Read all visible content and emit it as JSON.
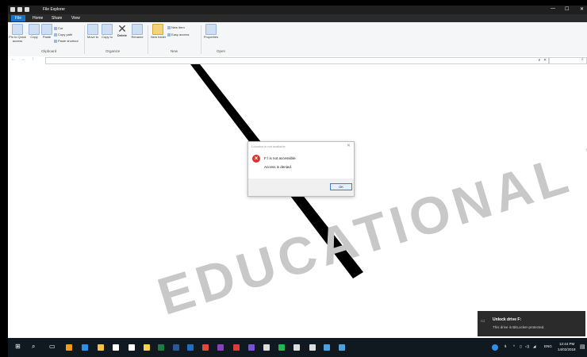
{
  "window": {
    "title": "File Explorer",
    "controls": {
      "minimize": "—",
      "maximize": "☐",
      "close": "✕"
    }
  },
  "tabs": [
    {
      "label": "File"
    },
    {
      "label": "Home"
    },
    {
      "label": "Share"
    },
    {
      "label": "View"
    }
  ],
  "ribbon": {
    "clipboard": {
      "pin": "Pin to Quick access",
      "copy": "Copy",
      "paste": "Paste",
      "cut": "Cut",
      "copy_path": "Copy path",
      "paste_shortcut": "Paste shortcut",
      "group": "Clipboard"
    },
    "organize": {
      "move_to": "Move to",
      "copy_to": "Copy to",
      "delete": "Delete",
      "rename": "Rename",
      "group": "Organize"
    },
    "new": {
      "new_item": "New item",
      "easy_access": "Easy access",
      "new_folder": "New folder",
      "group": "New"
    },
    "open": {
      "properties": "Properties",
      "group": "Open"
    }
  },
  "nav": {
    "back": "←",
    "forward": "→",
    "up": "↑"
  },
  "address": {
    "value": "",
    "dropdown": "∨",
    "clear": "✕"
  },
  "search": {
    "icon": "⌕"
  },
  "dialog": {
    "title": "Location is not available",
    "close": "✕",
    "message": "F:\\ is not accessible.",
    "detail": "Access is denied.",
    "ok_label": "OK"
  },
  "watermark": "EDUCATIONAL PRIVACY",
  "toast": {
    "title": "Unlock drive F:",
    "body": "This drive is BitLocker-protected."
  },
  "taskbar": {
    "apps": [
      {
        "icon": "start-icon",
        "color": "#ffffff"
      },
      {
        "icon": "search-icon",
        "color": "#ffffff"
      },
      {
        "icon": "task-view-icon",
        "color": "#ffffff"
      },
      {
        "icon": "vlc-icon",
        "color": "#f39c12"
      },
      {
        "icon": "edge-icon",
        "color": "#2e8fe8"
      },
      {
        "icon": "file-explorer-icon",
        "color": "#f5c342"
      },
      {
        "icon": "store-icon",
        "color": "#ffffff"
      },
      {
        "icon": "mail-icon",
        "color": "#ffffff"
      },
      {
        "icon": "sticky-notes-icon",
        "color": "#f7d34a"
      },
      {
        "icon": "excel-icon",
        "color": "#1e7b44"
      },
      {
        "icon": "word-icon",
        "color": "#2b579a"
      },
      {
        "icon": "outlook-icon",
        "color": "#1f6fc5"
      },
      {
        "icon": "chrome-icon",
        "color": "#e8453c"
      },
      {
        "icon": "onenote-icon",
        "color": "#8a3fbf"
      },
      {
        "icon": "acrobat-icon",
        "color": "#e03a3a"
      },
      {
        "icon": "premiere-icon",
        "color": "#7b4fd6"
      },
      {
        "icon": "calculator-icon",
        "color": "#dddddd"
      },
      {
        "icon": "spotify-icon",
        "color": "#1db954"
      },
      {
        "icon": "photos-icon",
        "color": "#dddddd"
      },
      {
        "icon": "settings-icon",
        "color": "#dddddd"
      },
      {
        "icon": "keyboard-icon",
        "color": "#4aa3df"
      },
      {
        "icon": "paint-icon",
        "color": "#4aa3df"
      }
    ],
    "tray": {
      "language": "ENG",
      "time": "12:44 PM",
      "date": "14/02/2018"
    }
  }
}
